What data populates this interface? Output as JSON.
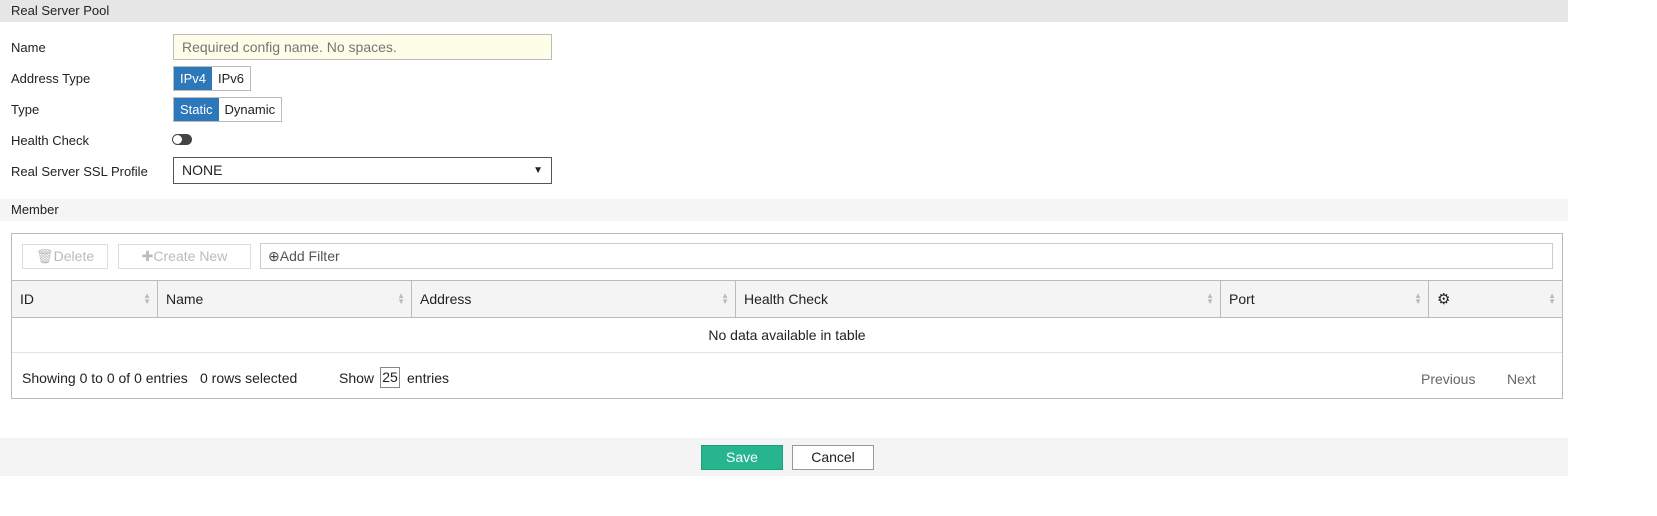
{
  "section_title": "Real Server Pool",
  "form": {
    "name_label": "Name",
    "name_placeholder": "Required config name. No spaces.",
    "address_type_label": "Address Type",
    "address_type_options": [
      "IPv4",
      "IPv6"
    ],
    "type_label": "Type",
    "type_options": [
      "Static",
      "Dynamic"
    ],
    "health_check_label": "Health Check",
    "health_check_enabled": false,
    "ssl_profile_label": "Real Server SSL Profile",
    "ssl_profile_value": "NONE"
  },
  "member": {
    "title": "Member",
    "toolbar": {
      "delete": "Delete",
      "create_new": "Create New",
      "add_filter": "Add Filter"
    },
    "columns": [
      "ID",
      "Name",
      "Address",
      "Health Check",
      "Port"
    ],
    "empty_message": "No data available in table",
    "showing": "Showing 0 to 0 of 0 entries",
    "rows_selected": "0 rows selected",
    "show_label": "Show",
    "page_size": "25",
    "entries_label": "entries",
    "previous": "Previous",
    "next": "Next"
  },
  "footer": {
    "save": "Save",
    "cancel": "Cancel"
  },
  "colors": {
    "accent": "#2d77bb",
    "save": "#26b58f"
  }
}
